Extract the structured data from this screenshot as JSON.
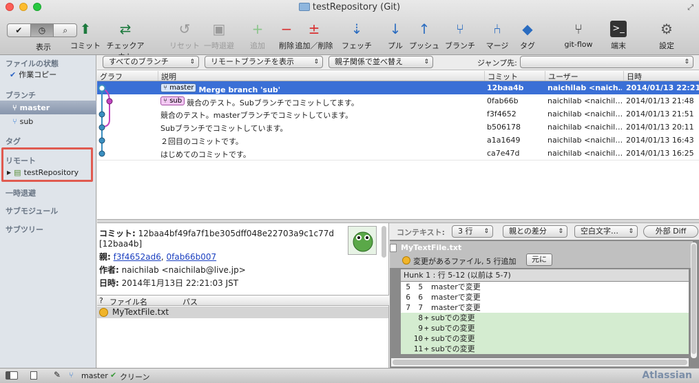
{
  "window": {
    "title": "testRepository (Git)"
  },
  "toolbar": {
    "view_label": "表示",
    "buttons": [
      {
        "label": "コミット",
        "icon": "commit-icon"
      },
      {
        "label": "チェックアウト",
        "icon": "checkout-icon"
      },
      {
        "label": "リセット",
        "icon": "reset-icon"
      },
      {
        "label": "一時退避",
        "icon": "stash-icon"
      },
      {
        "label": "追加",
        "icon": "add-icon"
      },
      {
        "label": "削除",
        "icon": "remove-icon"
      },
      {
        "label": "追加／削除",
        "icon": "add-remove-icon"
      },
      {
        "label": "フェッチ",
        "icon": "fetch-icon"
      },
      {
        "label": "プル",
        "icon": "pull-icon"
      },
      {
        "label": "プッシュ",
        "icon": "push-icon"
      },
      {
        "label": "ブランチ",
        "icon": "branch-icon"
      },
      {
        "label": "マージ",
        "icon": "merge-icon"
      },
      {
        "label": "タグ",
        "icon": "tag-icon"
      },
      {
        "label": "git-flow",
        "icon": "git-flow-icon"
      },
      {
        "label": "端末",
        "icon": "terminal-icon"
      },
      {
        "label": "設定",
        "icon": "settings-icon"
      }
    ]
  },
  "sidebar": {
    "file_status": "ファイルの状態",
    "working_copy": "作業コピー",
    "branches": "ブランチ",
    "branch_master": "master",
    "branch_sub": "sub",
    "tags": "タグ",
    "remotes": "リモート",
    "remote_repo": "testRepository",
    "stashes": "一時退避",
    "submodules": "サブモジュール",
    "subtrees": "サブツリー"
  },
  "filter": {
    "all_branches": "すべてのブランチ",
    "show_remote": "リモートブランチを表示",
    "ancestor_order": "親子関係で並べ替え",
    "jump_label": "ジャンプ先:"
  },
  "columns": {
    "graph": "グラフ",
    "desc": "説明",
    "commit": "コミット",
    "user": "ユーザー",
    "date": "日時"
  },
  "commits": [
    {
      "tag": "master",
      "desc": "Merge branch 'sub'",
      "hash": "12baa4b",
      "user": "naichilab <naich…",
      "date": "2014/01/13 22:21"
    },
    {
      "tag": "sub",
      "desc": "競合のテスト。Subブランチでコミットしてます。",
      "hash": "0fab66b",
      "user": "naichilab <naichil…",
      "date": "2014/01/13 21:48"
    },
    {
      "tag": "",
      "desc": "競合のテスト。masterブランチでコミットしています。",
      "hash": "f3f4652",
      "user": "naichilab <naichil…",
      "date": "2014/01/13 21:51"
    },
    {
      "tag": "",
      "desc": "Subブランチでコミットしています。",
      "hash": "b506178",
      "user": "naichilab <naichil…",
      "date": "2014/01/13 20:11"
    },
    {
      "tag": "",
      "desc": "２回目のコミットです。",
      "hash": "a1a1649",
      "user": "naichilab <naichil…",
      "date": "2014/01/13 16:43"
    },
    {
      "tag": "",
      "desc": "はじめてのコミットです。",
      "hash": "ca7e47d",
      "user": "naichilab <naichil…",
      "date": "2014/01/13 16:25"
    }
  ],
  "detail": {
    "commit_label": "コミット:",
    "commit_full": "12baa4bf49fa7f1be305dff048e22703a9c1c77d",
    "commit_short": "[12baa4b]",
    "parents_label": "親:",
    "parent1": "f3f4652ad6",
    "parent2": "0fab66b007",
    "author_label": "作者:",
    "author": "naichilab <naichilab@live.jp>",
    "date_label": "日時:",
    "date": "2014年1月13日 22:21:03 JST"
  },
  "files": {
    "col_q": "?",
    "col_name": "ファイル名",
    "col_path": "パス",
    "items": [
      {
        "name": "MyTextFile.txt"
      }
    ]
  },
  "diff": {
    "context_label": "コンテキスト:",
    "context_value": "3 行",
    "vs_parent": "親との差分",
    "whitespace": "空白文字…",
    "external_diff": "外部 Diff",
    "file_name": "MyTextFile.txt",
    "file_status": "変更があるファイル, 5 行追加",
    "revert": "元に",
    "hunk": "Hunk 1 : 行 5-12 (以前は 5-7)",
    "lines": [
      {
        "old": "5",
        "new": "5",
        "sign": "",
        "text": "masterで変更",
        "added": false
      },
      {
        "old": "6",
        "new": "6",
        "sign": "",
        "text": "masterで変更",
        "added": false
      },
      {
        "old": "7",
        "new": "7",
        "sign": "",
        "text": "masterで変更",
        "added": false
      },
      {
        "old": "",
        "new": "8",
        "sign": "+",
        "text": "subでの変更",
        "added": true
      },
      {
        "old": "",
        "new": "9",
        "sign": "+",
        "text": "subでの変更",
        "added": true
      },
      {
        "old": "",
        "new": "10",
        "sign": "+",
        "text": "subでの変更",
        "added": true
      },
      {
        "old": "",
        "new": "11",
        "sign": "+",
        "text": "subでの変更",
        "added": true
      }
    ]
  },
  "status": {
    "branch": "master",
    "clean": "クリーン",
    "brand": "Atlassian"
  }
}
